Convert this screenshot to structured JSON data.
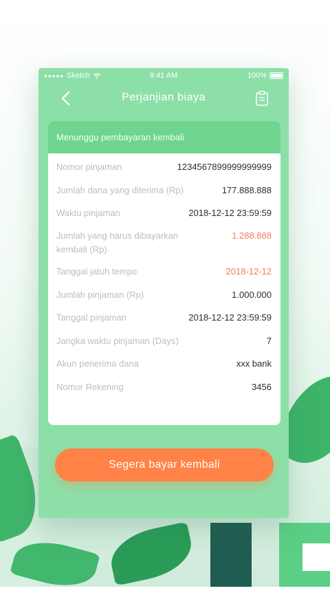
{
  "status_bar": {
    "carrier": "Sketch",
    "time": "9:41 AM",
    "battery": "100%"
  },
  "nav": {
    "title": "Perjanjian biaya"
  },
  "card": {
    "header": "Menunggu pembayaran kembali",
    "rows": [
      {
        "label": "Nomor pinjaman",
        "value": "1234567899999999999"
      },
      {
        "label": "Jumlah dana yang diterima (Rp)",
        "value": "177.888.888"
      },
      {
        "label": "Waktu pinjaman",
        "value": "2018-12-12 23:59:59"
      },
      {
        "label": "Jumlah yang harus dibayarkan kembali (Rp)",
        "value": "1.288.888"
      },
      {
        "label": "Tanggal jatuh tempo",
        "value": "2018-12-12"
      },
      {
        "label": "Jumlah pinjaman (Rp)",
        "value": "1.000.000"
      },
      {
        "label": "Tanggal pinjaman",
        "value": "2018-12-12 23:59:59"
      },
      {
        "label": "Jangka waktu pinjaman (Days)",
        "value": "7"
      },
      {
        "label": "Akun penerima dana",
        "value": "xxx bank"
      },
      {
        "label": "Nomor Rekening",
        "value": "3456"
      }
    ]
  },
  "button": {
    "label": "Segera bayar kembali"
  },
  "colors": {
    "accent": "#ff8246",
    "highlight": "#f27a5d",
    "header": "#6fd48f",
    "frame": "#8ddfa8"
  },
  "icons": {
    "back": "chevron-left-icon",
    "clipboard": "clipboard-icon",
    "wifi": "wifi-icon",
    "battery": "battery-icon"
  }
}
